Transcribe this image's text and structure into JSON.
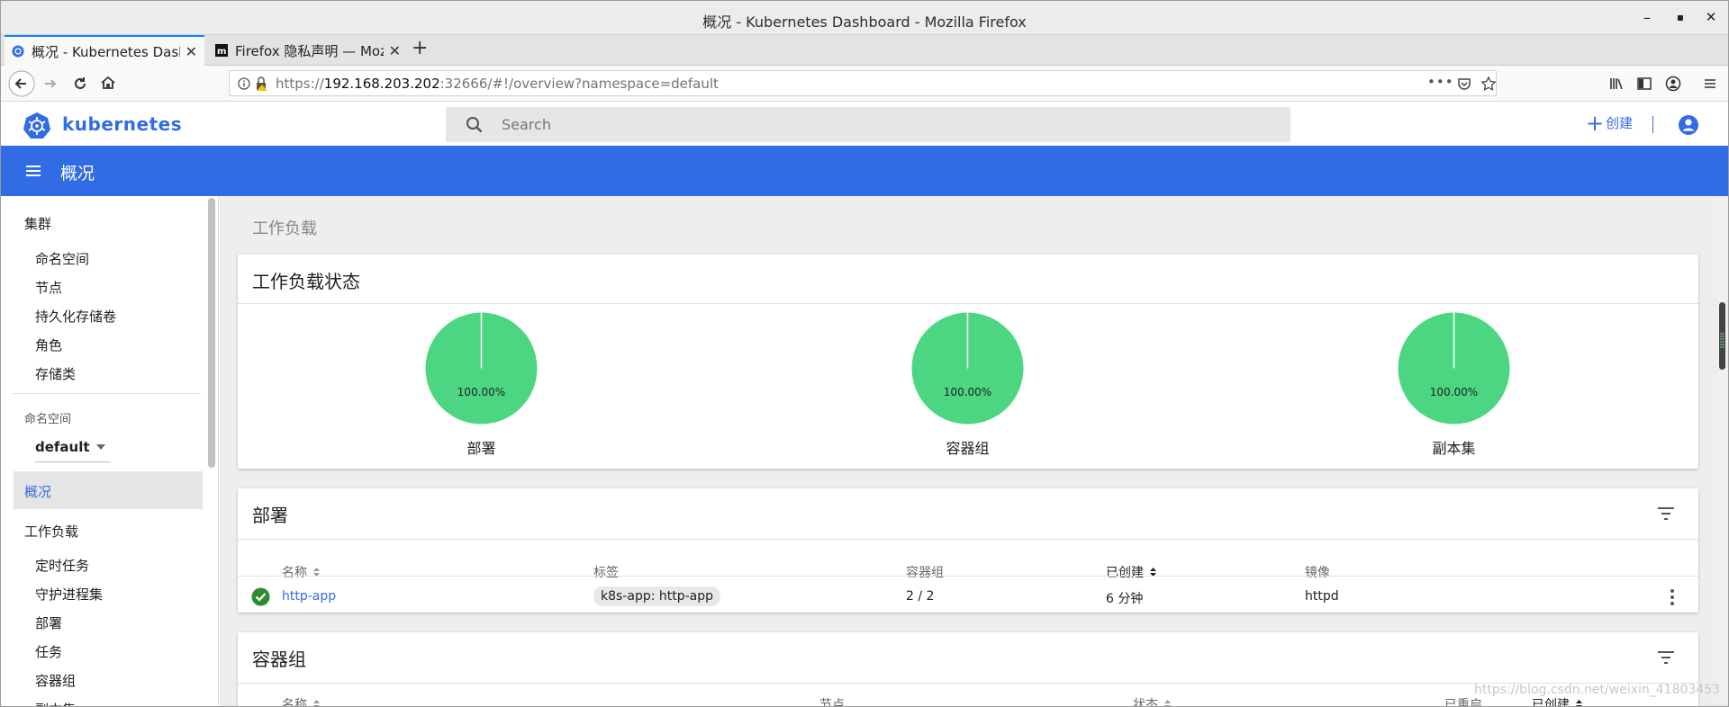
{
  "window": {
    "title": "概况 - Kubernetes Dashboard - Mozilla Firefox",
    "controls": {
      "minimize": "–",
      "maximize": "▪",
      "close": "✕"
    }
  },
  "tabs": [
    {
      "label": "概况 - Kubernetes Dashb",
      "active": true,
      "close": "✕"
    },
    {
      "label": "Firefox 隐私声明 — Mozi",
      "active": false,
      "close": "✕"
    }
  ],
  "newtab": "+",
  "nav": {
    "url_prefix": "https://",
    "url_host": "192.168.203.202",
    "url_rest": ":32666/#!/overview?namespace=default",
    "page_actions": "•••"
  },
  "header": {
    "brand": "kubernetes",
    "search_placeholder": "Search",
    "create_plus": "+",
    "create_label": "创建"
  },
  "toolbar": {
    "title": "概况"
  },
  "sidebar": {
    "cluster_heading": "集群",
    "cluster_items": [
      "命名空间",
      "节点",
      "持久化存储卷",
      "角色",
      "存储类"
    ],
    "namespace_label": "命名空间",
    "namespace_value": "default",
    "overview": "概况",
    "workloads_heading": "工作负载",
    "workload_items": [
      "定时任务",
      "守护进程集",
      "部署",
      "任务",
      "容器组",
      "副本集"
    ]
  },
  "main": {
    "section_title": "工作负载",
    "status_card": {
      "title": "工作负载状态",
      "pies": [
        {
          "label": "部署",
          "percent": "100.00%",
          "value": 100
        },
        {
          "label": "容器组",
          "percent": "100.00%",
          "value": 100
        },
        {
          "label": "副本集",
          "percent": "100.00%",
          "value": 100
        }
      ],
      "pie_color": "#4cd681"
    },
    "deployments": {
      "title": "部署",
      "columns": [
        "名称",
        "标签",
        "容器组",
        "已创建",
        "镜像"
      ],
      "rows": [
        {
          "name": "http-app",
          "label": "k8s-app: http-app",
          "pods": "2 / 2",
          "created": "6 分钟",
          "image": "httpd",
          "status": "ok"
        }
      ]
    },
    "pods": {
      "title": "容器组",
      "columns": [
        "名称",
        "节点",
        "状态",
        "已重启",
        "已创建"
      ]
    }
  },
  "watermark": "https://blog.csdn.net/weixin_41803453",
  "colors": {
    "brand": "#326ce5",
    "success": "#2e8b2e"
  }
}
